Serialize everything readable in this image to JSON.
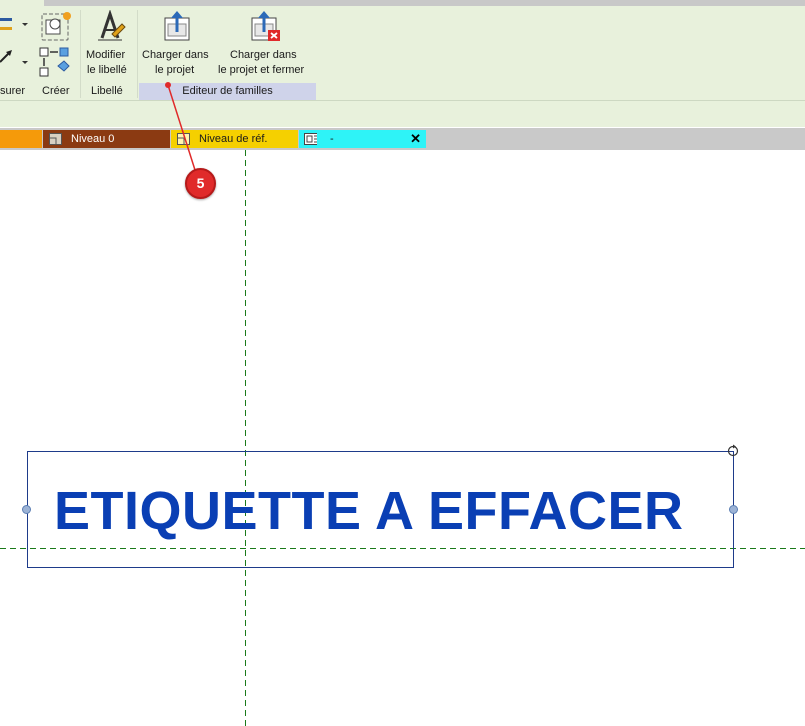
{
  "ribbon": {
    "measure_fragment": "surer",
    "create_panel_title": "Créer",
    "modify_label_button": {
      "line1": "Modifier",
      "line2": "le libellé"
    },
    "label_panel_title": "Libellé",
    "load_into_project_button": {
      "line1": "Charger dans",
      "line2": "le projet"
    },
    "load_and_close_button": {
      "line1": "Charger dans",
      "line2": "le projet et fermer"
    },
    "family_editor_panel_title": "Editeur de familles"
  },
  "view_tabs": [
    {
      "label": "Niveau 0",
      "icon": "floor-plan-icon",
      "bg": "#8b3a12",
      "fg": "#ffffff"
    },
    {
      "label": "Niveau de réf.",
      "icon": "floor-plan-icon",
      "bg": "#f5d000",
      "fg": "#1a1a1a"
    },
    {
      "label": "-",
      "icon": "sheet-view-icon",
      "bg": "#2ef3f7",
      "fg": "#1a1a1a",
      "close": "✕"
    }
  ],
  "canvas": {
    "tag_text": "ETIQUETTE A EFFACER",
    "tag_color": "#0a3fb4",
    "reference_line_color": "#1a7a1a"
  },
  "callout": {
    "number": "5",
    "color": "#e02a2a"
  },
  "colors": {
    "ribbon_bg": "#e8f1dc",
    "panel_highlight": "#cfd3ea",
    "orange_tab": "#f59a0a"
  }
}
